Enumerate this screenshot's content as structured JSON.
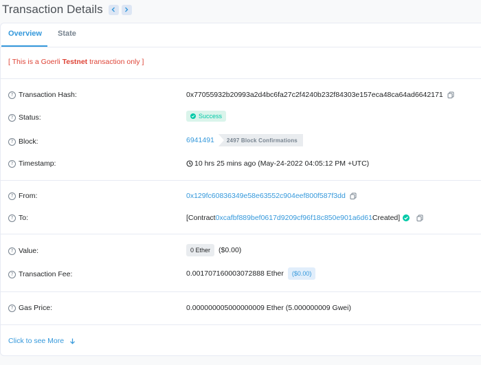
{
  "header": {
    "title": "Transaction Details"
  },
  "tabs": [
    {
      "label": "Overview"
    },
    {
      "label": "State"
    }
  ],
  "notice": {
    "prefix": "[ This is a Goerli ",
    "bold": "Testnet",
    "suffix": " transaction only ]"
  },
  "rows": {
    "hash": {
      "label": "Transaction Hash:",
      "value": "0x77055932b20993a2d4bc6fa27c2f4240b232f84303e157eca48ca64ad6642171"
    },
    "status": {
      "label": "Status:",
      "value": "Success"
    },
    "block": {
      "label": "Block:",
      "value": "6941491",
      "confirmations": "2497 Block Confirmations"
    },
    "timestamp": {
      "label": "Timestamp:",
      "value": "10 hrs 25 mins ago (May-24-2022 04:05:12 PM +UTC)"
    },
    "from": {
      "label": "From:",
      "value": "0x129fc60836349e58e63552c904eef800f587f3dd"
    },
    "to": {
      "label": "To:",
      "prefix": "[Contract ",
      "address": "0xcafbf889bef0617d9209cf96f18c850e901a6d61",
      "suffix": " Created]"
    },
    "value": {
      "label": "Value:",
      "ether": "0 Ether",
      "usd": "($0.00)"
    },
    "fee": {
      "label": "Transaction Fee:",
      "value": "0.001707160003072888 Ether",
      "usd": "($0.00)"
    },
    "gas": {
      "label": "Gas Price:",
      "value": "0.000000005000000009 Ether (5.000000009 Gwei)"
    }
  },
  "more": {
    "label": "Click to see More"
  },
  "icons": {
    "help": "?"
  },
  "colors": {
    "accent": "#3498db",
    "success": "#00c9a7",
    "danger": "#de4437"
  }
}
